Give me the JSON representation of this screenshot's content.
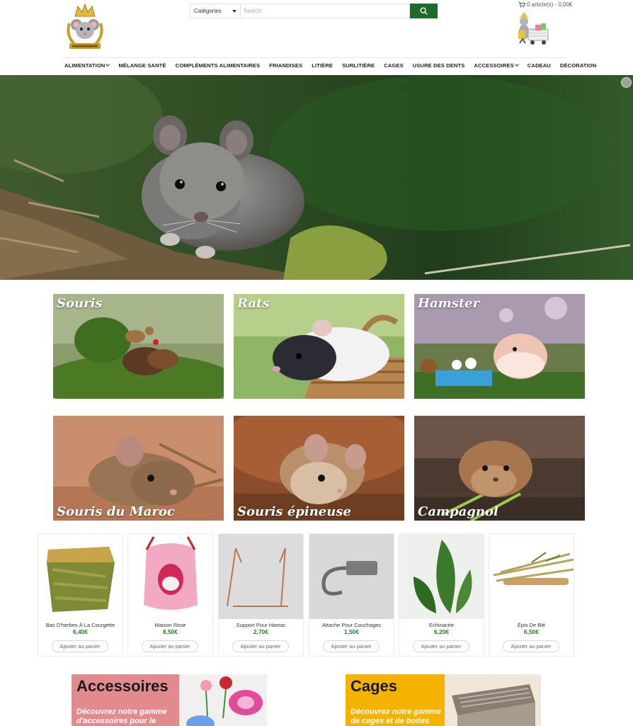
{
  "header": {
    "search": {
      "category_label": "Catégories",
      "placeholder": "Search"
    },
    "cart": {
      "summary": "0 article(s) - 0,00€"
    }
  },
  "nav": {
    "items": [
      {
        "label": "ALIMENTATION",
        "dropdown": true
      },
      {
        "label": "MÉLANGE SANTÉ",
        "dropdown": false
      },
      {
        "label": "COMPLÉMENTS ALIMENTAIRES",
        "dropdown": false
      },
      {
        "label": "FRIANDISES",
        "dropdown": false
      },
      {
        "label": "LITIÈRE",
        "dropdown": false
      },
      {
        "label": "SURLITIÈRE",
        "dropdown": false
      },
      {
        "label": "CAGES",
        "dropdown": false
      },
      {
        "label": "USURE DES DENTS",
        "dropdown": false
      },
      {
        "label": "ACCESSOIRES",
        "dropdown": true
      },
      {
        "label": "CADEAU",
        "dropdown": false
      },
      {
        "label": "DÉCORATION",
        "dropdown": false
      }
    ]
  },
  "categories": [
    {
      "label": "Souris"
    },
    {
      "label": "Rats"
    },
    {
      "label": "Hamster"
    },
    {
      "label": "Souris du Maroc"
    },
    {
      "label": "Souris épineuse"
    },
    {
      "label": "Campagnol"
    }
  ],
  "products": [
    {
      "name": "Bac D'herbes À La Courgette",
      "price": "6,40€",
      "button": "Ajouter au panier"
    },
    {
      "name": "Maison Rose",
      "price": "8,50€",
      "button": "Ajouter au panier"
    },
    {
      "name": "Support Pour Hamac",
      "price": "2,70€",
      "button": "Ajouter au panier"
    },
    {
      "name": "Attache Pour Couchages",
      "price": "1,50€",
      "button": "Ajouter au panier"
    },
    {
      "name": "Echinacée",
      "price": "6,20€",
      "button": "Ajouter au panier"
    },
    {
      "name": "Épis De Blé",
      "price": "6,50€",
      "button": "Ajouter au panier"
    }
  ],
  "banners": [
    {
      "title": "Accessoires",
      "desc": "Découvrez notre gamme d'accessoires pour le",
      "color": "#e38a8e"
    },
    {
      "title": "Cages",
      "desc": "Découvrez notre gamme de cages et de boites",
      "color": "#f5b300"
    }
  ],
  "colors": {
    "accent": "#1e6b2a",
    "price": "#2a7a2a"
  }
}
